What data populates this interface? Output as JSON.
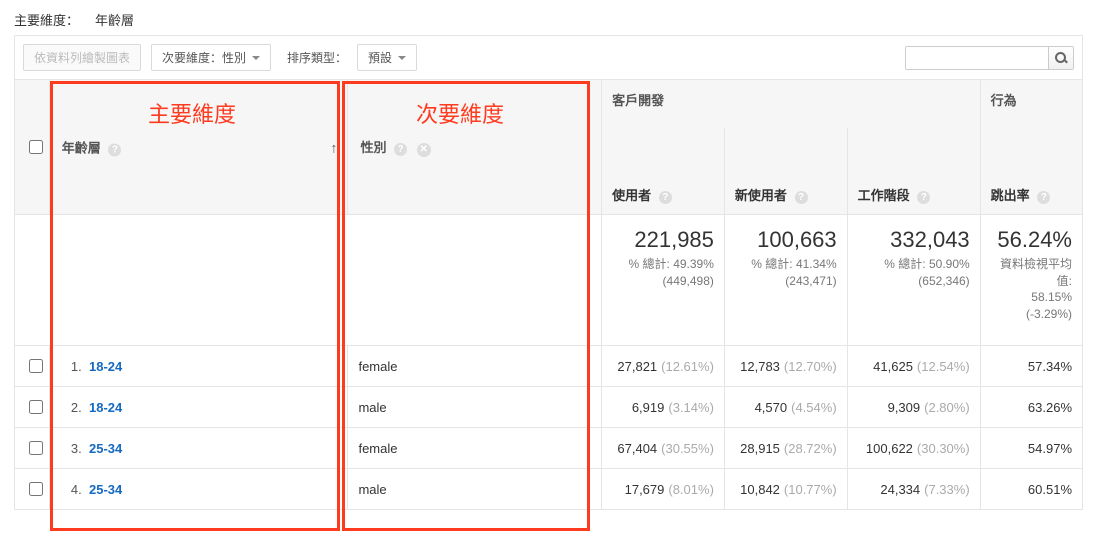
{
  "primary_dim": {
    "label": "主要維度：",
    "value": "年齡層"
  },
  "toolbar": {
    "plot_rows": "依資料列繪製圖表",
    "secondary_dim": "次要維度：性別",
    "sort_type_label": "排序類型：",
    "sort_default": "預設"
  },
  "annotations": {
    "primary": "主要維度",
    "secondary": "次要維度"
  },
  "headers": {
    "group_acquisition": "客戶開發",
    "group_behavior": "行為",
    "age": "年齡層",
    "gender": "性別",
    "users": "使用者",
    "new_users": "新使用者",
    "sessions": "工作階段",
    "bounce_rate": "跳出率"
  },
  "totals": {
    "users": {
      "value": "221,985",
      "sub1": "% 總計: 49.39%",
      "sub2": "(449,498)"
    },
    "new_users": {
      "value": "100,663",
      "sub1": "% 總計: 41.34%",
      "sub2": "(243,471)"
    },
    "sessions": {
      "value": "332,043",
      "sub1": "% 總計: 50.90%",
      "sub2": "(652,346)"
    },
    "bounce": {
      "value": "56.24%",
      "sub1": "資料檢視平均值:",
      "sub2": "58.15%",
      "sub3": "(-3.29%)"
    }
  },
  "rows": [
    {
      "idx": "1.",
      "age": "18-24",
      "gender": "female",
      "users_v": "27,821",
      "users_p": "(12.61%)",
      "new_v": "12,783",
      "new_p": "(12.70%)",
      "sess_v": "41,625",
      "sess_p": "(12.54%)",
      "bounce": "57.34%"
    },
    {
      "idx": "2.",
      "age": "18-24",
      "gender": "male",
      "users_v": "6,919",
      "users_p": "(3.14%)",
      "new_v": "4,570",
      "new_p": "(4.54%)",
      "sess_v": "9,309",
      "sess_p": "(2.80%)",
      "bounce": "63.26%"
    },
    {
      "idx": "3.",
      "age": "25-34",
      "gender": "female",
      "users_v": "67,404",
      "users_p": "(30.55%)",
      "new_v": "28,915",
      "new_p": "(28.72%)",
      "sess_v": "100,622",
      "sess_p": "(30.30%)",
      "bounce": "54.97%"
    },
    {
      "idx": "4.",
      "age": "25-34",
      "gender": "male",
      "users_v": "17,679",
      "users_p": "(8.01%)",
      "new_v": "10,842",
      "new_p": "(10.77%)",
      "sess_v": "24,334",
      "sess_p": "(7.33%)",
      "bounce": "60.51%"
    }
  ]
}
